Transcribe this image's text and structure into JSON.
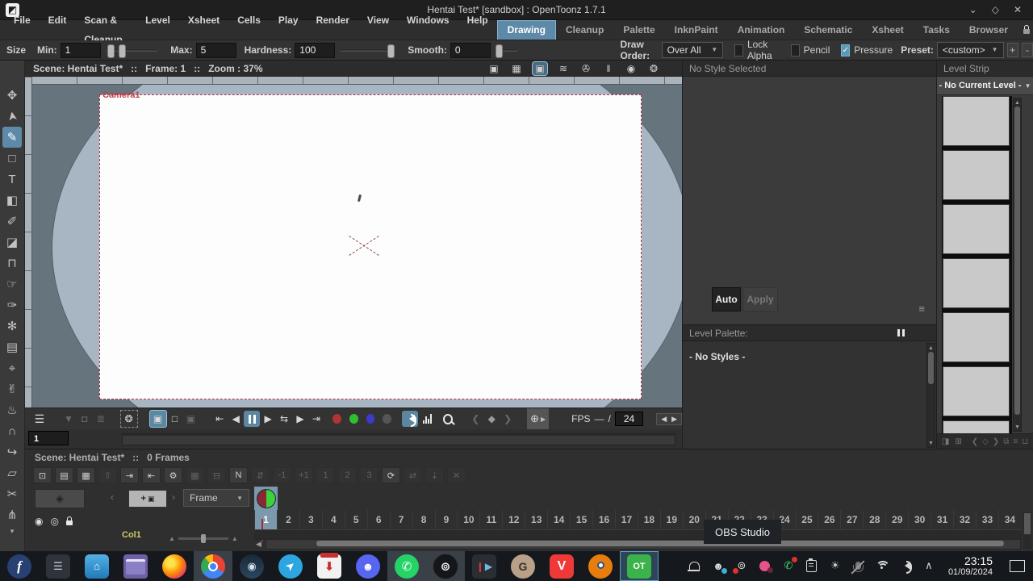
{
  "window": {
    "title": "Hentai Test* [sandbox] : OpenToonz 1.7.1",
    "controls": {
      "minimize": "⌄",
      "maximize": "◇",
      "close": "✕"
    }
  },
  "menus": [
    "File",
    "Edit",
    "Scan & Cleanup",
    "Level",
    "Xsheet",
    "Cells",
    "Play",
    "Render",
    "View",
    "Windows",
    "Help"
  ],
  "rooms": {
    "active": "Drawing",
    "tabs": [
      "Drawing",
      "Cleanup",
      "Palette",
      "InknPaint",
      "Animation",
      "Schematic",
      "Xsheet",
      "Tasks",
      "Browser"
    ]
  },
  "options": {
    "size_label": "Size",
    "min_label": "Min:",
    "min_value": "1",
    "max_label": "Max:",
    "max_value": "5",
    "hardness_label": "Hardness:",
    "hardness_value": "100",
    "smooth_label": "Smooth:",
    "smooth_value": "0",
    "draw_order_label": "Draw Order:",
    "draw_order_value": "Over All",
    "lock_alpha_label": "Lock Alpha",
    "pencil_label": "Pencil",
    "pressure_label": "Pressure",
    "pressure_checked": true,
    "check_glyph": "✓",
    "preset_label": "Preset:",
    "preset_value": "<custom>",
    "add_preset": "+",
    "remove_preset": "-"
  },
  "tools": [
    {
      "name": "animate-tool",
      "glyph": "✥"
    },
    {
      "name": "selection-tool",
      "glyph": "➤",
      "rot": true
    },
    {
      "name": "brush-tool",
      "glyph": "✎",
      "active": true
    },
    {
      "name": "geometric-tool",
      "glyph": "□"
    },
    {
      "name": "type-tool",
      "glyph": "T"
    },
    {
      "name": "fill-tool",
      "glyph": "◧"
    },
    {
      "name": "smart-raster-brush-tool",
      "glyph": "✐"
    },
    {
      "name": "eraser-tool",
      "glyph": "◪"
    },
    {
      "name": "tape-tool",
      "glyph": "⊓"
    },
    {
      "name": "style-picker-tool",
      "glyph": "☞"
    },
    {
      "name": "rgb-picker-tool",
      "glyph": "✑"
    },
    {
      "name": "freehand-picker-tool",
      "glyph": "✻"
    },
    {
      "name": "ruler-tool",
      "glyph": "▤"
    },
    {
      "name": "control-point-editor-tool",
      "glyph": "⌖"
    },
    {
      "name": "pinch-tool",
      "glyph": "✌"
    },
    {
      "name": "pump-tool",
      "glyph": "♨"
    },
    {
      "name": "magnet-tool",
      "glyph": "∩"
    },
    {
      "name": "bender-tool",
      "glyph": "↪"
    },
    {
      "name": "iron-tool",
      "glyph": "▱"
    },
    {
      "name": "cutter-tool",
      "glyph": "✂"
    },
    {
      "name": "skeleton-tool",
      "glyph": "⋔"
    }
  ],
  "tools_more_glyph": "▾",
  "viewer": {
    "scene_info": "Scene: Hentai Test*",
    "sep": "::",
    "frame_info": "Frame: 1",
    "zoom_info": "Zoom : 37%",
    "camera_label": "Camera1",
    "header_icons": [
      {
        "name": "camera-view-icon",
        "glyph": "▣"
      },
      {
        "name": "table-view-icon",
        "glyph": "▦"
      },
      {
        "name": "3d-view-icon",
        "glyph": "▣",
        "active": true
      },
      {
        "name": "onion-skin-icon",
        "glyph": "≋"
      },
      {
        "name": "camera-capture-icon",
        "glyph": "✇"
      },
      {
        "name": "freeze-icon",
        "glyph": "‖"
      },
      {
        "name": "preview-icon",
        "glyph": "◉"
      },
      {
        "name": "sub-camera-preview-icon",
        "glyph": "❂"
      }
    ]
  },
  "playback": {
    "menu_glyph": "☰",
    "fps_label": "FPS",
    "fps_current": "—",
    "fps_sep": "/",
    "fps_total": "24",
    "frame_current": "1"
  },
  "style_panel": {
    "header": "No Style Selected",
    "auto_label": "Auto",
    "apply_label": "Apply"
  },
  "palette_panel": {
    "header": "Level Palette:",
    "empty_text": "- No Styles -"
  },
  "level_strip": {
    "header": "Level Strip",
    "current_level": "- No Current Level -",
    "thumb_count": 7
  },
  "xsheet": {
    "scene_info": "Scene: Hentai Test*",
    "sep": "::",
    "frames_info": "0 Frames",
    "frame_mode": "Frame",
    "frame_count": 34,
    "active_frame": 1,
    "col_label": "Col1",
    "add_frame_glyph": "+",
    "toolbar": [
      {
        "name": "new-toonz-raster-level-icon",
        "glyph": "⊡",
        "dim": false
      },
      {
        "name": "new-raster-level-icon",
        "glyph": "▤",
        "dim": false
      },
      {
        "name": "new-vector-level-icon",
        "glyph": "▦",
        "dim": false
      },
      {
        "name": "reframe-icon",
        "glyph": "⇧",
        "dim": true
      },
      {
        "name": "load-into-cells-icon",
        "glyph": "⇥",
        "dim": false
      },
      {
        "name": "save-cells-icon",
        "glyph": "⇤",
        "dim": false
      },
      {
        "name": "camera-test-icon",
        "glyph": "⚙",
        "dim": false
      },
      {
        "name": "edit-in-place-icon",
        "glyph": "▦",
        "dim": true
      },
      {
        "name": "collapse-icon",
        "glyph": "⊟",
        "dim": true
      },
      {
        "name": "toggle-numbering-icon",
        "glyph": "N",
        "dim": false
      },
      {
        "name": "swap-cells-icon",
        "glyph": "⇵",
        "dim": true
      },
      {
        "name": "dec-step-icon",
        "glyph": "-1",
        "dim": true
      },
      {
        "name": "inc-step-icon",
        "glyph": "+1",
        "dim": true
      },
      {
        "name": "step-1-icon",
        "glyph": "1",
        "dim": true
      },
      {
        "name": "step-2-icon",
        "glyph": "2",
        "dim": true
      },
      {
        "name": "step-3-icon",
        "glyph": "3",
        "dim": true
      },
      {
        "name": "repeat-icon",
        "glyph": "⟳",
        "dim": false
      },
      {
        "name": "swing-icon",
        "glyph": "⇄",
        "dim": true
      },
      {
        "name": "drop-down-icon",
        "glyph": "⇣",
        "dim": true
      },
      {
        "name": "clear-icon",
        "glyph": "✕",
        "dim": true
      }
    ]
  },
  "tooltip": {
    "text": "OBS Studio"
  },
  "taskbar": {
    "apps": [
      {
        "name": "fedora-menu",
        "cls": "app-fedora",
        "glyph": "f"
      },
      {
        "name": "settings",
        "cls": "app-settings",
        "glyph": "☰"
      },
      {
        "name": "software-store",
        "cls": "app-software",
        "glyph": "⌂"
      },
      {
        "name": "file-manager",
        "cls": "app-files",
        "glyph": ""
      },
      {
        "name": "firefox",
        "cls": "app-firefox",
        "glyph": ""
      },
      {
        "name": "chrome",
        "cls": "app-chrome",
        "glyph": "",
        "hl": true
      },
      {
        "name": "steam",
        "cls": "app-steam",
        "glyph": "◉"
      },
      {
        "name": "telegram",
        "cls": "app-telegram",
        "glyph": "➤",
        "plane": true
      },
      {
        "name": "package-installer",
        "cls": "app-package",
        "glyph": "⬇"
      },
      {
        "name": "discord",
        "cls": "app-discord",
        "glyph": "☻"
      },
      {
        "name": "whatsapp",
        "cls": "app-whatsapp",
        "glyph": "✆",
        "hl": true
      },
      {
        "name": "obs-studio",
        "cls": "app-obs",
        "glyph": "⊚",
        "hl": true
      },
      {
        "name": "kdenlive",
        "cls": "app-kdenlive",
        "glyph": "▶",
        "kden": true
      },
      {
        "name": "gimp",
        "cls": "app-gimp",
        "glyph": "G"
      },
      {
        "name": "vivaldi",
        "cls": "app-vivaldi",
        "glyph": "V"
      },
      {
        "name": "blender",
        "cls": "app-blender",
        "glyph": ""
      },
      {
        "name": "opentoonz",
        "cls": "app-opentoonz",
        "glyph": "OT",
        "active": true
      }
    ],
    "clock": {
      "time": "23:15",
      "date": "01/09/2024"
    }
  }
}
